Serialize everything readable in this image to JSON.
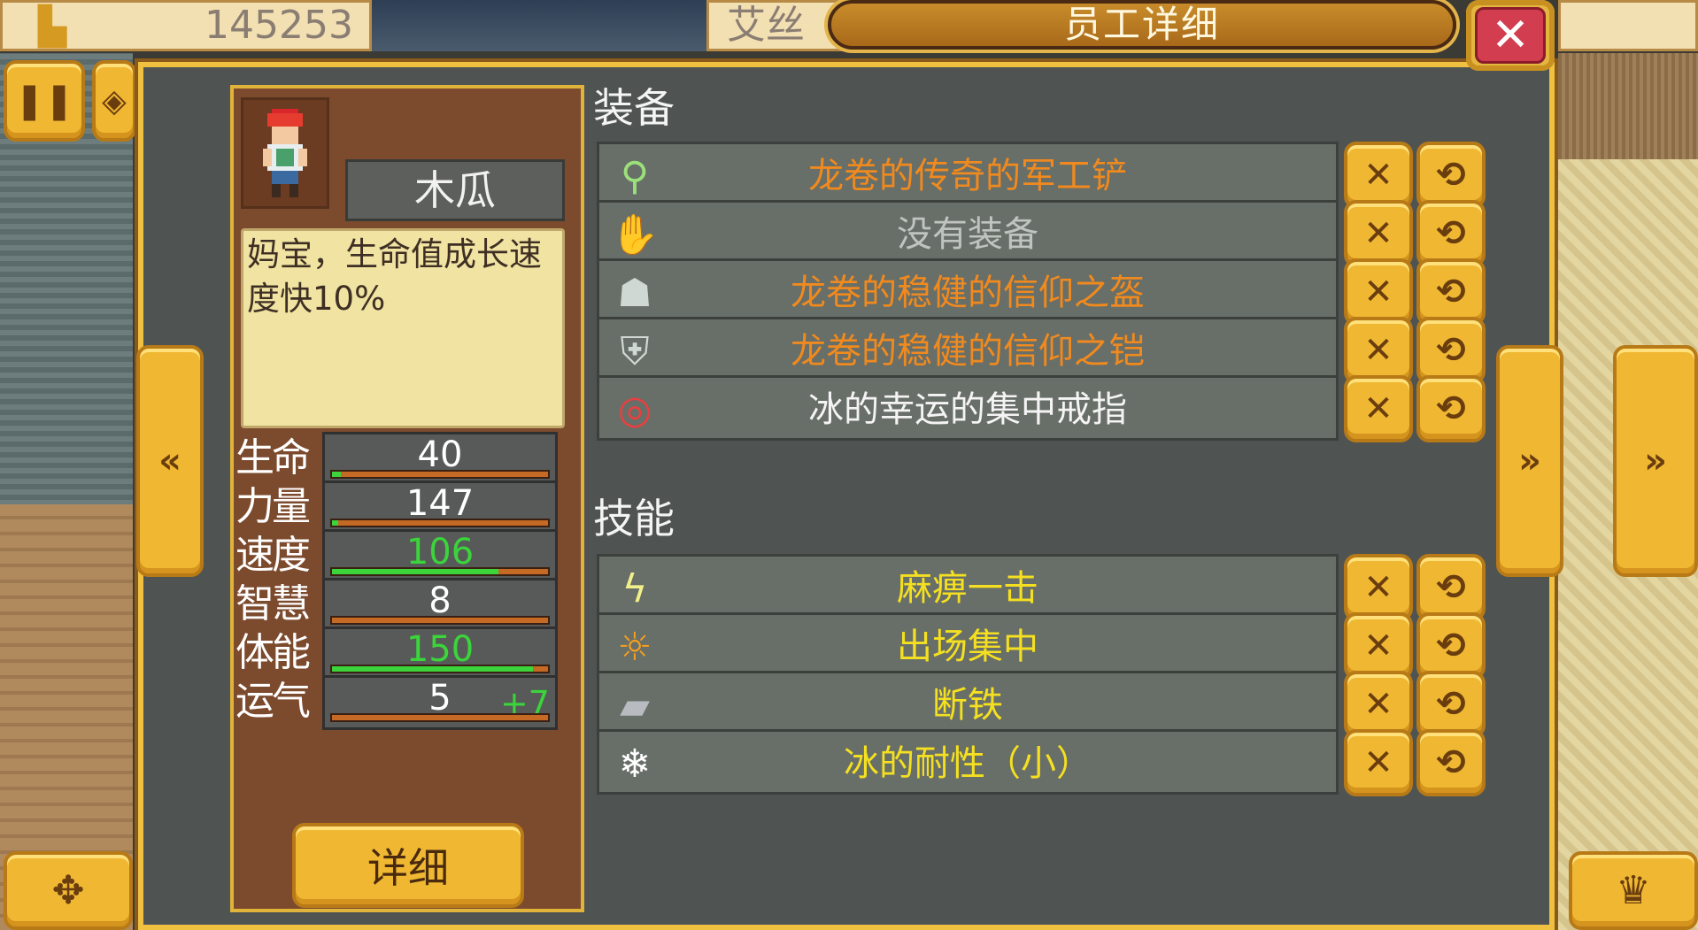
{
  "top_bar": {
    "gold_amount": "145253",
    "name_partial": "艾丝"
  },
  "title": "员工详细",
  "character": {
    "name": "木瓜",
    "description": "妈宝，生命值成长速度快10%",
    "stats": [
      {
        "label": "生命",
        "value": "40",
        "bonus": "",
        "value_color": "#ffffff",
        "progress": 0.04
      },
      {
        "label": "力量",
        "value": "147",
        "bonus": "",
        "value_color": "#ffffff",
        "progress": 0.03
      },
      {
        "label": "速度",
        "value": "106",
        "bonus": "",
        "value_color": "#3bd43b",
        "progress": 0.77
      },
      {
        "label": "智慧",
        "value": "8",
        "bonus": "",
        "value_color": "#ffffff",
        "progress": 0.0
      },
      {
        "label": "体能",
        "value": "150",
        "bonus": "",
        "value_color": "#3bd43b",
        "progress": 0.93
      },
      {
        "label": "运气",
        "value": "5",
        "bonus": "+7",
        "value_color": "#ffffff",
        "progress": 0.0
      }
    ],
    "detail_button": "详细"
  },
  "equipment": {
    "title": "装备",
    "items": [
      {
        "label": "龙卷的传奇的军工铲",
        "color": "#f08a1e",
        "icon": "shovel-icon"
      },
      {
        "label": "没有装备",
        "color": "#c0c4c0",
        "icon": "glove-icon"
      },
      {
        "label": "龙卷的稳健的信仰之盔",
        "color": "#f08a1e",
        "icon": "helmet-icon"
      },
      {
        "label": "龙卷的稳健的信仰之铠",
        "color": "#f08a1e",
        "icon": "armor-icon"
      },
      {
        "label": "冰的幸运的集中戒指",
        "color": "#f4f4f4",
        "icon": "ring-icon"
      }
    ]
  },
  "skills": {
    "title": "技能",
    "items": [
      {
        "label": "麻痹一击",
        "color": "#f4e020",
        "icon": "lightning-icon"
      },
      {
        "label": "出场集中",
        "color": "#f4e020",
        "icon": "focus-icon"
      },
      {
        "label": "断铁",
        "color": "#f4e020",
        "icon": "iron-icon"
      },
      {
        "label": "冰的耐性（小）",
        "color": "#f4e020",
        "icon": "ice-resist-icon"
      }
    ]
  },
  "icons": {
    "remove": "✕",
    "swap": "⟲",
    "prev": "«",
    "next": "»",
    "close": "✕"
  }
}
